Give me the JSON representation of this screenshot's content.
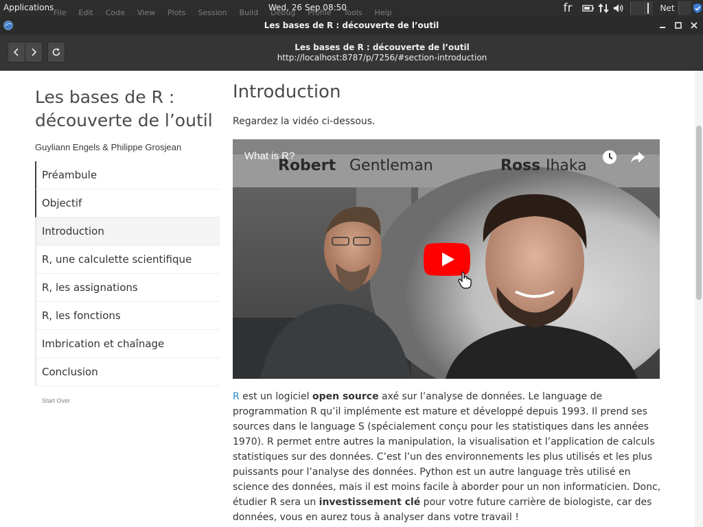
{
  "system_panel": {
    "applications_label": "Applications",
    "clock": "Wed, 26 Sep  08:50",
    "network_label": "Net",
    "background_menu": [
      "File",
      "Edit",
      "Code",
      "View",
      "Plots",
      "Session",
      "Build",
      "Debug",
      "Profile",
      "Tools",
      "Help"
    ],
    "keyboard_layout": "fr"
  },
  "window": {
    "title": "Les bases de R : découverte de l’outil"
  },
  "toolbar": {
    "page_title": "Les bases de R : découverte de l’outil",
    "url": "http://localhost:8787/p/7256/#section-introduction"
  },
  "sidebar": {
    "doc_title": "Les bases de R : découverte de l’outil",
    "authors": "Guyliann Engels & Philippe Grosjean",
    "items": [
      {
        "label": "Préambule"
      },
      {
        "label": "Objectif"
      },
      {
        "label": "Introduction"
      },
      {
        "label": "R, une calculette scientifique"
      },
      {
        "label": "R, les assignations"
      },
      {
        "label": "R, les fonctions"
      },
      {
        "label": "Imbrication et chaînage"
      },
      {
        "label": "Conclusion"
      }
    ],
    "start_over": "Start Over"
  },
  "main": {
    "section_title": "Introduction",
    "intro": "Regardez la vidéo ci-dessous.",
    "video": {
      "title": "What is R?",
      "name_left_first": "Robert",
      "name_left_last": "Gentleman",
      "name_right_first": "Ross",
      "name_right_last": "Ihaka"
    },
    "paragraph": {
      "r_link": "R",
      "t1": " est un logiciel ",
      "b1": "open source",
      "t2": " axé sur l’analyse de données. Le language de programmation R qu’il implémente est mature et développé depuis 1993. Il prend ses sources dans le language S (spécialement conçu pour les statistiques dans les années 1970). R permet entre autres la manipulation, la visualisation et l’application de calculs statistiques sur des données. C’est l’un des environnements les plus utilisés et les plus puissants pour l’analyse des données. Python est un autre language très utilisé en science des données, mais il est moins facile à aborder pour un non informaticien. Donc, étudier R sera un ",
      "b2": "investissement clé",
      "t3": " pour votre future carrière de biologiste, car des données, vous en aurez tous à analyser dans votre travail !"
    }
  },
  "colors": {
    "link": "#2a8ed0",
    "youtube_red": "#ff0000",
    "panel": "#2d2d2d"
  }
}
